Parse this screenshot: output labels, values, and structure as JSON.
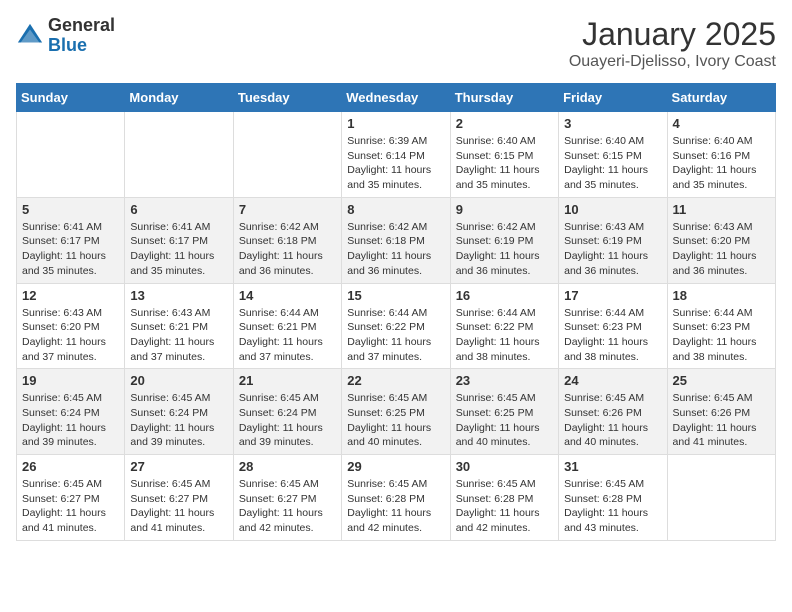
{
  "logo": {
    "general": "General",
    "blue": "Blue"
  },
  "header": {
    "title": "January 2025",
    "subtitle": "Ouayeri-Djelisso, Ivory Coast"
  },
  "weekdays": [
    "Sunday",
    "Monday",
    "Tuesday",
    "Wednesday",
    "Thursday",
    "Friday",
    "Saturday"
  ],
  "weeks": [
    [
      {
        "day": "",
        "info": ""
      },
      {
        "day": "",
        "info": ""
      },
      {
        "day": "",
        "info": ""
      },
      {
        "day": "1",
        "info": "Sunrise: 6:39 AM\nSunset: 6:14 PM\nDaylight: 11 hours and 35 minutes."
      },
      {
        "day": "2",
        "info": "Sunrise: 6:40 AM\nSunset: 6:15 PM\nDaylight: 11 hours and 35 minutes."
      },
      {
        "day": "3",
        "info": "Sunrise: 6:40 AM\nSunset: 6:15 PM\nDaylight: 11 hours and 35 minutes."
      },
      {
        "day": "4",
        "info": "Sunrise: 6:40 AM\nSunset: 6:16 PM\nDaylight: 11 hours and 35 minutes."
      }
    ],
    [
      {
        "day": "5",
        "info": "Sunrise: 6:41 AM\nSunset: 6:17 PM\nDaylight: 11 hours and 35 minutes."
      },
      {
        "day": "6",
        "info": "Sunrise: 6:41 AM\nSunset: 6:17 PM\nDaylight: 11 hours and 35 minutes."
      },
      {
        "day": "7",
        "info": "Sunrise: 6:42 AM\nSunset: 6:18 PM\nDaylight: 11 hours and 36 minutes."
      },
      {
        "day": "8",
        "info": "Sunrise: 6:42 AM\nSunset: 6:18 PM\nDaylight: 11 hours and 36 minutes."
      },
      {
        "day": "9",
        "info": "Sunrise: 6:42 AM\nSunset: 6:19 PM\nDaylight: 11 hours and 36 minutes."
      },
      {
        "day": "10",
        "info": "Sunrise: 6:43 AM\nSunset: 6:19 PM\nDaylight: 11 hours and 36 minutes."
      },
      {
        "day": "11",
        "info": "Sunrise: 6:43 AM\nSunset: 6:20 PM\nDaylight: 11 hours and 36 minutes."
      }
    ],
    [
      {
        "day": "12",
        "info": "Sunrise: 6:43 AM\nSunset: 6:20 PM\nDaylight: 11 hours and 37 minutes."
      },
      {
        "day": "13",
        "info": "Sunrise: 6:43 AM\nSunset: 6:21 PM\nDaylight: 11 hours and 37 minutes."
      },
      {
        "day": "14",
        "info": "Sunrise: 6:44 AM\nSunset: 6:21 PM\nDaylight: 11 hours and 37 minutes."
      },
      {
        "day": "15",
        "info": "Sunrise: 6:44 AM\nSunset: 6:22 PM\nDaylight: 11 hours and 37 minutes."
      },
      {
        "day": "16",
        "info": "Sunrise: 6:44 AM\nSunset: 6:22 PM\nDaylight: 11 hours and 38 minutes."
      },
      {
        "day": "17",
        "info": "Sunrise: 6:44 AM\nSunset: 6:23 PM\nDaylight: 11 hours and 38 minutes."
      },
      {
        "day": "18",
        "info": "Sunrise: 6:44 AM\nSunset: 6:23 PM\nDaylight: 11 hours and 38 minutes."
      }
    ],
    [
      {
        "day": "19",
        "info": "Sunrise: 6:45 AM\nSunset: 6:24 PM\nDaylight: 11 hours and 39 minutes."
      },
      {
        "day": "20",
        "info": "Sunrise: 6:45 AM\nSunset: 6:24 PM\nDaylight: 11 hours and 39 minutes."
      },
      {
        "day": "21",
        "info": "Sunrise: 6:45 AM\nSunset: 6:24 PM\nDaylight: 11 hours and 39 minutes."
      },
      {
        "day": "22",
        "info": "Sunrise: 6:45 AM\nSunset: 6:25 PM\nDaylight: 11 hours and 40 minutes."
      },
      {
        "day": "23",
        "info": "Sunrise: 6:45 AM\nSunset: 6:25 PM\nDaylight: 11 hours and 40 minutes."
      },
      {
        "day": "24",
        "info": "Sunrise: 6:45 AM\nSunset: 6:26 PM\nDaylight: 11 hours and 40 minutes."
      },
      {
        "day": "25",
        "info": "Sunrise: 6:45 AM\nSunset: 6:26 PM\nDaylight: 11 hours and 41 minutes."
      }
    ],
    [
      {
        "day": "26",
        "info": "Sunrise: 6:45 AM\nSunset: 6:27 PM\nDaylight: 11 hours and 41 minutes."
      },
      {
        "day": "27",
        "info": "Sunrise: 6:45 AM\nSunset: 6:27 PM\nDaylight: 11 hours and 41 minutes."
      },
      {
        "day": "28",
        "info": "Sunrise: 6:45 AM\nSunset: 6:27 PM\nDaylight: 11 hours and 42 minutes."
      },
      {
        "day": "29",
        "info": "Sunrise: 6:45 AM\nSunset: 6:28 PM\nDaylight: 11 hours and 42 minutes."
      },
      {
        "day": "30",
        "info": "Sunrise: 6:45 AM\nSunset: 6:28 PM\nDaylight: 11 hours and 42 minutes."
      },
      {
        "day": "31",
        "info": "Sunrise: 6:45 AM\nSunset: 6:28 PM\nDaylight: 11 hours and 43 minutes."
      },
      {
        "day": "",
        "info": ""
      }
    ]
  ]
}
